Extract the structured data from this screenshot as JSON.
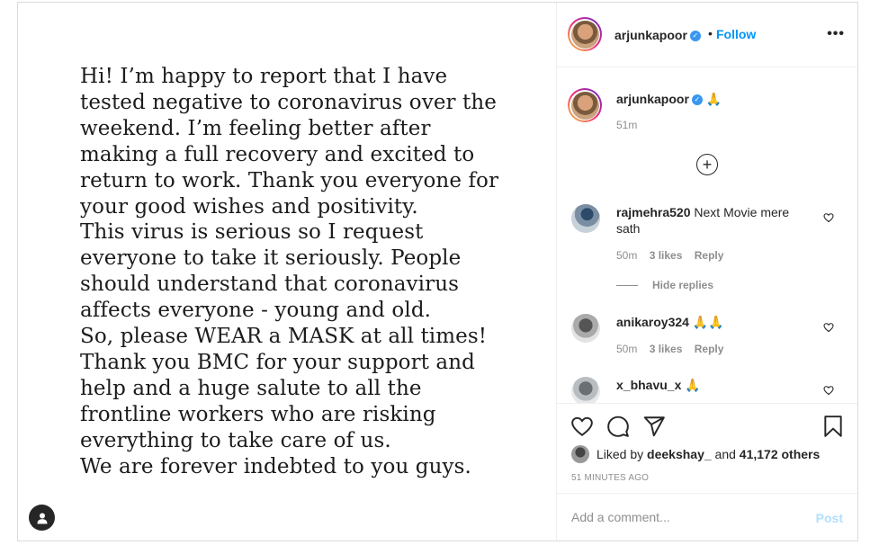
{
  "post_image": {
    "lines": [
      "Hi! I’m happy to report that I have",
      "tested negative to coronavirus over the",
      "weekend. I’m feeling better after",
      "making a full recovery and excited to",
      "return to work. Thank you everyone for",
      "your good wishes and positivity.",
      "This virus is serious so I request",
      "everyone to take it seriously. People",
      "should understand that coronavirus",
      "affects everyone - young and old.",
      "So, please WEAR a MASK at all times!",
      "Thank you BMC for your support and",
      "help and a huge salute to all the",
      "frontline workers who are risking",
      "everything to take care of us.",
      "We are forever indebted to you guys."
    ],
    "user_tag_icon": "person-icon"
  },
  "header": {
    "username": "arjunkapoor",
    "dot": "•",
    "follow_label": "Follow",
    "more_icon": "•••"
  },
  "caption": {
    "username": "arjunkapoor",
    "emoji": "🙏",
    "time": "51m",
    "load_more_icon": "+"
  },
  "comments": [
    {
      "username": "rajmehra520",
      "text": "Next Movie mere sath",
      "time": "50m",
      "likes": "3 likes",
      "reply": "Reply"
    },
    {
      "hide_replies": "Hide replies"
    },
    {
      "username": "anikaroy324",
      "text": "🙏🙏",
      "time": "50m",
      "likes": "3 likes",
      "reply": "Reply"
    },
    {
      "username": "x_bhavu_x",
      "text": "🙏"
    }
  ],
  "actions": {
    "liked_by_prefix": "Liked by",
    "liked_by_user": "deekshay_",
    "liked_by_and": "and",
    "liked_by_others": "41,172 others",
    "time_ago": "51 MINUTES AGO"
  },
  "add_comment": {
    "placeholder": "Add a comment...",
    "post_label": "Post"
  },
  "colors": {
    "link_blue": "#0095f6",
    "post_disabled": "#b2dffc",
    "muted": "#8e8e8e",
    "verified": "#3897f0"
  }
}
